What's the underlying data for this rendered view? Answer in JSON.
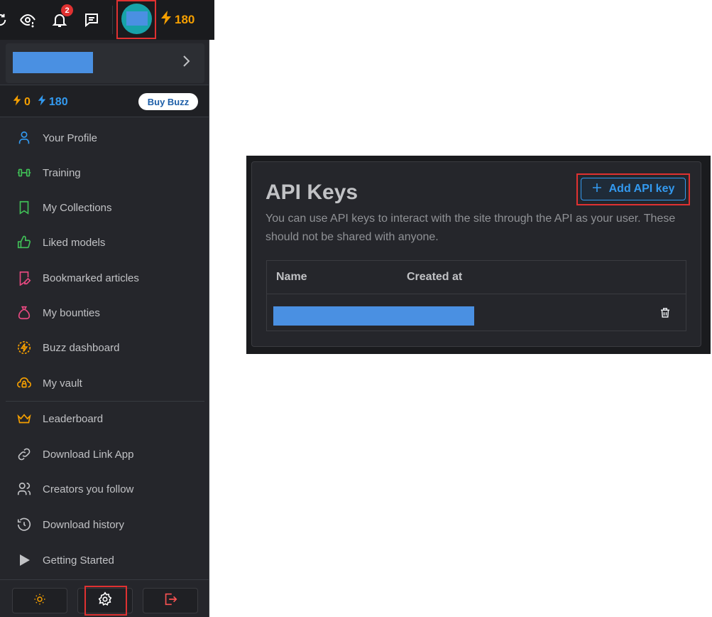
{
  "header": {
    "notification_count": "2",
    "buzz_amount": "180",
    "icons": [
      "sync-icon",
      "eye-icon",
      "bell-icon",
      "feedback-icon",
      "avatar",
      "lightning-icon"
    ]
  },
  "buzz_row": {
    "yellow_buzz": "0",
    "blue_buzz": "180",
    "buy_button": "Buy Buzz"
  },
  "menu": {
    "items": [
      {
        "label": "Your Profile",
        "icon": "user-icon",
        "color": "#339af0"
      },
      {
        "label": "Training",
        "icon": "dumbbell-icon",
        "color": "#40c057"
      },
      {
        "label": "My Collections",
        "icon": "bookmark-icon",
        "color": "#40c057"
      },
      {
        "label": "Liked models",
        "icon": "thumb-up-icon",
        "color": "#40c057"
      },
      {
        "label": "Bookmarked articles",
        "icon": "bookmark-edit-icon",
        "color": "#e64980"
      },
      {
        "label": "My bounties",
        "icon": "moneybag-icon",
        "color": "#e64980"
      },
      {
        "label": "Buzz dashboard",
        "icon": "buzz-circle-icon",
        "color": "#f59f00"
      },
      {
        "label": "My vault",
        "icon": "cloud-lock-icon",
        "color": "#f59f00"
      },
      {
        "label": "Leaderboard",
        "icon": "crown-icon",
        "color": "#f59f00"
      },
      {
        "label": "Download Link App",
        "icon": "link-icon",
        "color": "#c1c2c5"
      },
      {
        "label": "Creators you follow",
        "icon": "users-icon",
        "color": "#c1c2c5"
      },
      {
        "label": "Download history",
        "icon": "history-icon",
        "color": "#c1c2c5"
      },
      {
        "label": "Getting Started",
        "icon": "play-icon",
        "color": "#c1c2c5"
      }
    ]
  },
  "bottom_buttons": [
    "sun-icon",
    "settings-icon",
    "logout-icon"
  ],
  "api_keys": {
    "title": "API Keys",
    "description": "You can use API keys to interact with the site through the API as your user. These should not be shared with anyone.",
    "add_button": "Add API key",
    "columns": [
      "Name",
      "Created at"
    ]
  }
}
